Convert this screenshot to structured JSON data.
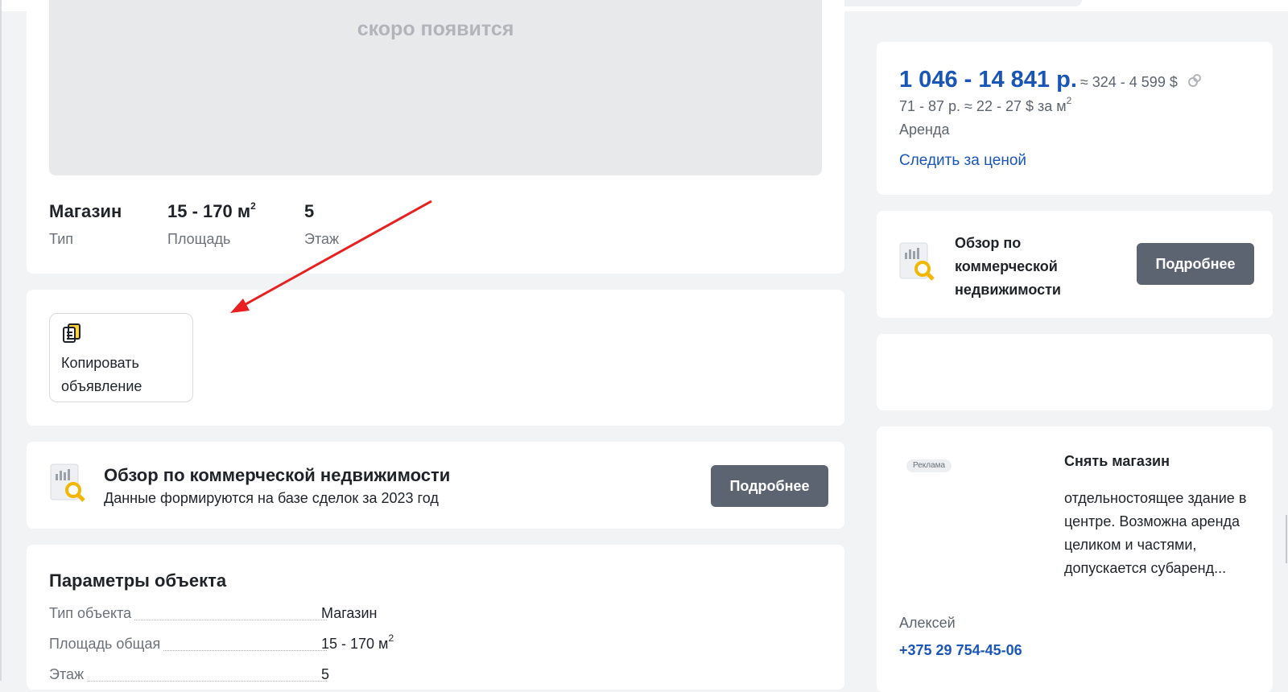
{
  "listing": {
    "photo_placeholder": "скоро появится",
    "stats": [
      {
        "value": "Магазин",
        "label": "Тип"
      },
      {
        "value": "15 - 170 м",
        "label": "Площадь"
      },
      {
        "value": "5",
        "label": "Этаж"
      }
    ],
    "copy_button": {
      "line1": "Копировать",
      "line2": "объявление"
    },
    "overview": {
      "title": "Обзор по коммерческой недвижимости",
      "subtitle": "Данные формируются на базе сделок за 2023 год",
      "button": "Подробнее"
    },
    "params": {
      "title": "Параметры объекта",
      "rows": [
        {
          "key": "Тип объекта",
          "value": "Магазин"
        },
        {
          "key": "Площадь общая",
          "value": "15 - 170 м"
        },
        {
          "key": "Этаж",
          "value": "5"
        }
      ]
    }
  },
  "sidebar": {
    "price": {
      "range_byn": "1 046 - 14 841 р.",
      "range_usd": "≈ 324 - 4 599 $",
      "per_m2": "71 - 87 р. ≈ 22 - 27 $ за м",
      "deal_type": "Аренда",
      "watch_link": "Следить за ценой"
    },
    "overview": {
      "line1": "Обзор по",
      "line2": "коммерческой",
      "line3": "недвижимости",
      "button": "Подробнее"
    },
    "ad": {
      "tag": "Реклама",
      "title": "Снять магазин",
      "text": "отдельностоящее здание в центре. Возможна аренда целиком и частями, допускается субаренд...",
      "seller": "Алексей",
      "phone": "+375 29 754-45-06"
    }
  },
  "colors": {
    "accent_link": "#1a56b8",
    "button_dark": "#5b6470",
    "annotation_arrow": "#e8201f",
    "page_bg": "#f2f3f5"
  }
}
